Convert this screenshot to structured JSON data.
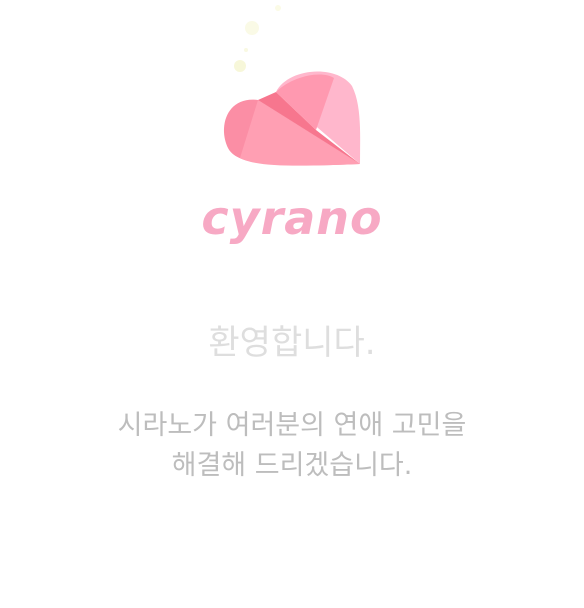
{
  "splash": {
    "brand_name": "cyrano",
    "welcome_text": "환영합니다.",
    "message_line1": "시라노가 여러분의 연애 고민을",
    "message_line2": "해결해 드리겠습니다."
  },
  "icons": {
    "logo": "folded-heart-logo-icon",
    "sparkles": "sparkle-icon"
  },
  "colors": {
    "background": "#ffffff",
    "brand_pink": "#f7a9c4",
    "heart_dark": "#fb7f96",
    "heart_light": "#ffb7cc",
    "welcome_text": "#dedede",
    "message_text": "#bdbdbd"
  }
}
